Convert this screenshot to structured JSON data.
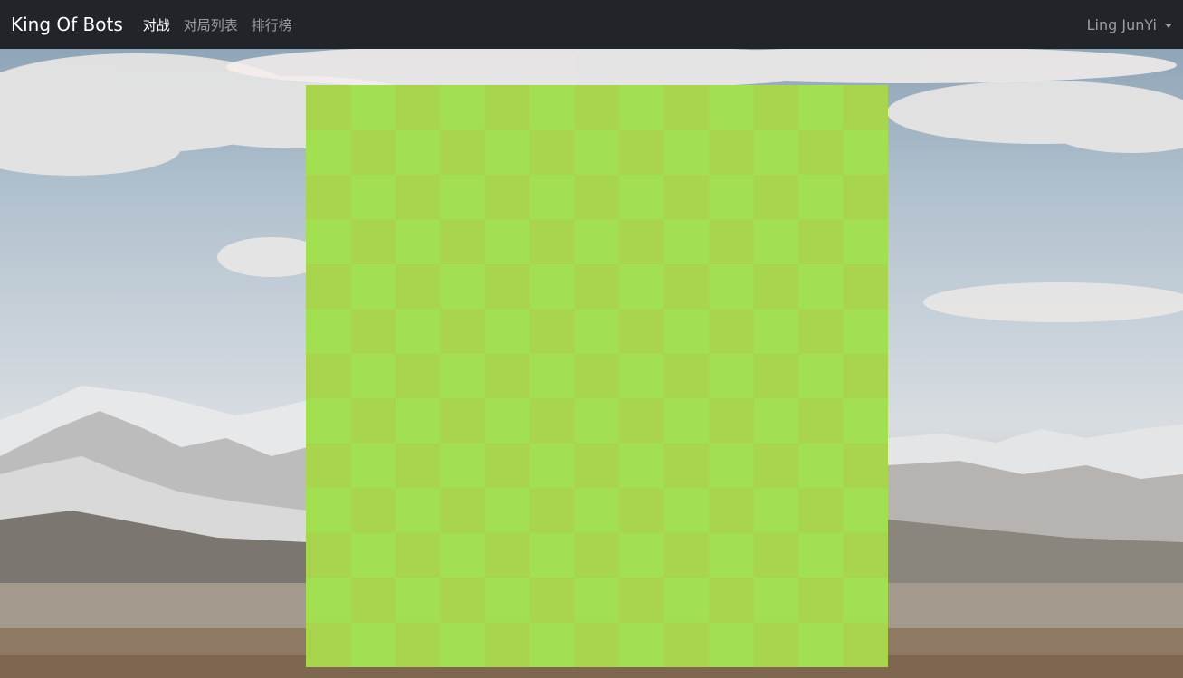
{
  "navbar": {
    "brand": "King Of Bots",
    "links": [
      {
        "label": "对战",
        "active": true
      },
      {
        "label": "对局列表",
        "active": false
      },
      {
        "label": "排行榜",
        "active": false
      }
    ],
    "user": "Ling JunYi"
  },
  "board": {
    "rows": 13,
    "cols": 13,
    "colors": {
      "light": "#A2E052",
      "dark": "#A9D44E"
    }
  },
  "icons": {
    "user_menu": "chevron-down-icon"
  }
}
